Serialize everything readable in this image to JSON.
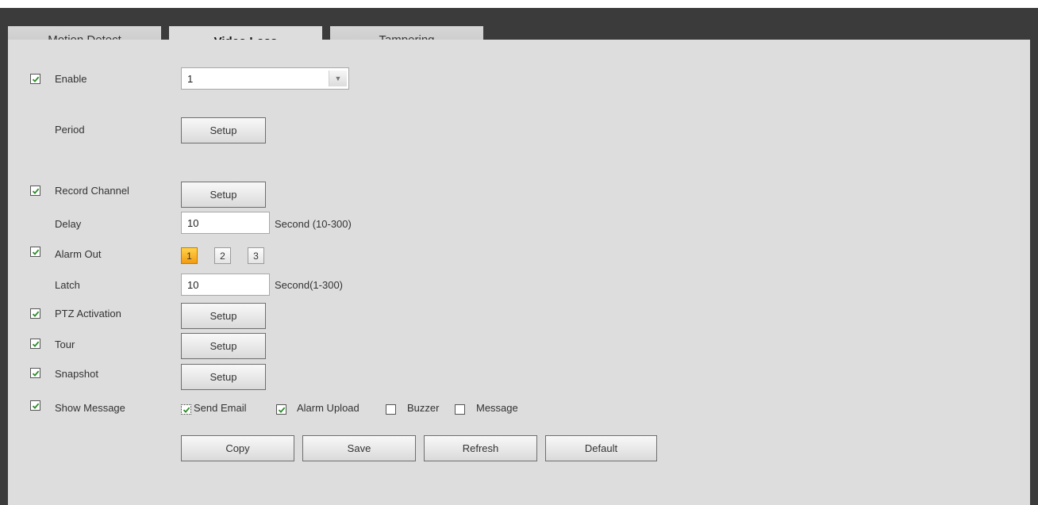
{
  "tabs": [
    {
      "label": "Motion Detect",
      "active": false
    },
    {
      "label": "Video Loss",
      "active": true
    },
    {
      "label": "Tampering",
      "active": false
    }
  ],
  "enable": {
    "label": "Enable",
    "checked": true,
    "channel_value": "1"
  },
  "period": {
    "label": "Period",
    "button": "Setup"
  },
  "record_channel": {
    "label": "Record Channel",
    "checked": true,
    "button": "Setup"
  },
  "delay": {
    "label": "Delay",
    "value": "10",
    "unit": "Second (10-300)"
  },
  "alarm_out": {
    "label": "Alarm Out",
    "checked": true,
    "outputs": [
      "1",
      "2",
      "3"
    ],
    "selected": "1"
  },
  "latch": {
    "label": "Latch",
    "value": "10",
    "unit": "Second(1-300)"
  },
  "ptz_activation": {
    "label": "PTZ Activation",
    "checked": true,
    "button": "Setup"
  },
  "tour": {
    "label": "Tour",
    "checked": true,
    "button": "Setup"
  },
  "snapshot": {
    "label": "Snapshot",
    "checked": true,
    "button": "Setup"
  },
  "show_message": {
    "label": "Show Message",
    "checked": true,
    "options": [
      {
        "label": "Send Email",
        "checked": true
      },
      {
        "label": "Alarm Upload",
        "checked": true
      },
      {
        "label": "Buzzer",
        "checked": false
      },
      {
        "label": "Message",
        "checked": false
      }
    ]
  },
  "actions": {
    "copy": "Copy",
    "save": "Save",
    "refresh": "Refresh",
    "default": "Default"
  },
  "colors": {
    "check": "#2a8a2a",
    "accent": "#f5a623",
    "panel": "#dddddd",
    "frame": "#3b3b3b"
  }
}
